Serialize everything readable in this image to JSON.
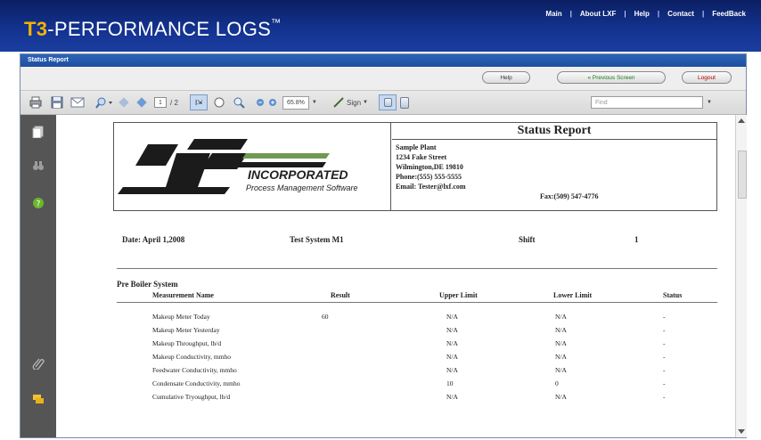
{
  "app": {
    "logo_prefix": "T3",
    "logo_text": "-PERFORMANCE LOGS",
    "logo_tm": "™"
  },
  "nav": [
    "Main",
    "About LXF",
    "Help",
    "Contact",
    "FeedBack"
  ],
  "panel": {
    "title": "Status Report",
    "buttons": {
      "help": "Help",
      "previous": "« Previous Screen",
      "logout": "Logout"
    }
  },
  "toolbar": {
    "page_current": "1",
    "page_total": "/ 2",
    "zoom": "65.8%",
    "sign": "Sign",
    "find_placeholder": "Find"
  },
  "report": {
    "company_name": "INCORPORATED",
    "company_tagline": "Process Management Software",
    "title": "Status Report",
    "address_lines": [
      "Sample Plant",
      "1234 Fake Street",
      "Wilmington,DE 19810",
      "Phone:(555) 555-5555",
      "Email: Tester@lxf.com"
    ],
    "fax": "Fax:(509) 547-4776",
    "date": "Date: April 1,2008",
    "system": "Test System M1",
    "shift_label": "Shift",
    "shift_value": "1",
    "section": "Pre Boiler System",
    "columns": [
      "Measurement Name",
      "Result",
      "Upper Limit",
      "Lower Limit",
      "Status"
    ],
    "rows": [
      {
        "name": "Makeup Meter Today",
        "result": "60",
        "upper": "N/A",
        "lower": "N/A",
        "status": "-"
      },
      {
        "name": "Makeup Meter Yesterday",
        "result": "",
        "upper": "N/A",
        "lower": "N/A",
        "status": "-"
      },
      {
        "name": "Makeup Throughput, lb/d",
        "result": "",
        "upper": "N/A",
        "lower": "N/A",
        "status": "-"
      },
      {
        "name": "Makeup Conductivity, mmho",
        "result": "",
        "upper": "N/A",
        "lower": "N/A",
        "status": "-"
      },
      {
        "name": "Feedwater Conductivity, mmho",
        "result": "",
        "upper": "N/A",
        "lower": "N/A",
        "status": "-"
      },
      {
        "name": "Condensate Conductivity, mmho",
        "result": "",
        "upper": "10",
        "lower": "0",
        "status": "-"
      },
      {
        "name": "Cumulative Tryoughput, lb/d",
        "result": "",
        "upper": "N/A",
        "lower": "N/A",
        "status": "-"
      }
    ]
  },
  "colors": {
    "header_blue": "#13328f",
    "logo_accent": "#f2b400",
    "prev_green": "#197a1e",
    "logout_red": "#b00000"
  }
}
